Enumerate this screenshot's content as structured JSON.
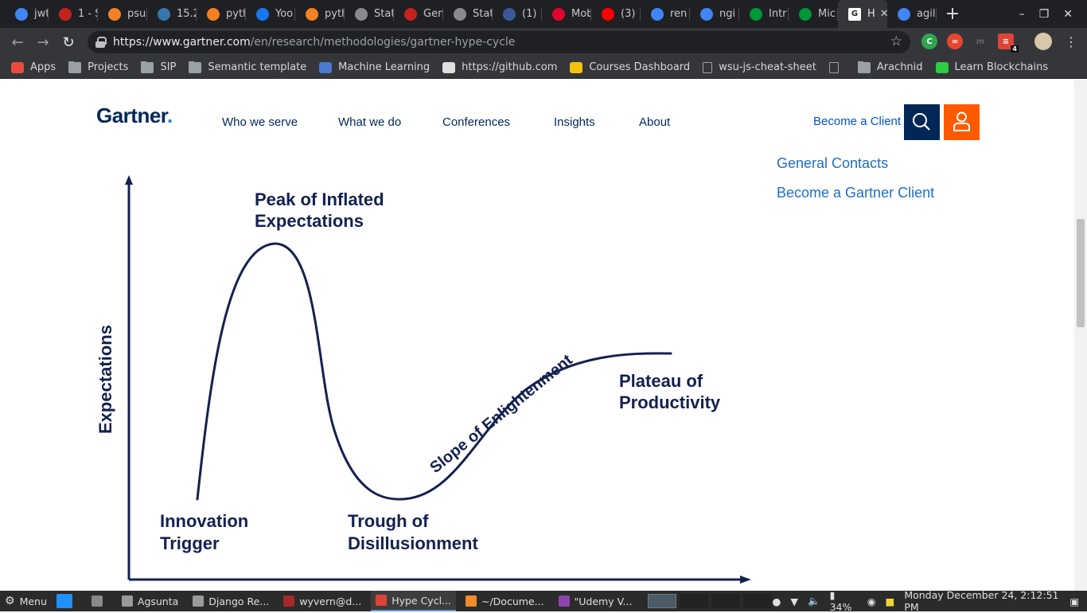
{
  "browser": {
    "tabs": [
      {
        "label": "jwt",
        "icon": "google-icon",
        "color": "#4285f4"
      },
      {
        "label": "1 - S",
        "icon": "red-figure-icon",
        "color": "#c5221f"
      },
      {
        "label": "psu",
        "icon": "stackoverflow-icon",
        "color": "#f48024"
      },
      {
        "label": "15.2",
        "icon": "python-icon",
        "color": "#3776ab"
      },
      {
        "label": "pyth",
        "icon": "stackoverflow-icon",
        "color": "#f48024"
      },
      {
        "label": "Yoo",
        "icon": "messenger-icon",
        "color": "#1877f2"
      },
      {
        "label": "pyth",
        "icon": "stackoverflow-icon",
        "color": "#f48024"
      },
      {
        "label": "Stat",
        "icon": "page-icon",
        "color": "#8a8a8a"
      },
      {
        "label": "Gen",
        "icon": "red-figure-icon",
        "color": "#c5221f"
      },
      {
        "label": "Stat",
        "icon": "page-icon",
        "color": "#8a8a8a"
      },
      {
        "label": "(1)",
        "icon": "facebook-icon",
        "color": "#3b5998"
      },
      {
        "label": "Mob",
        "icon": "huawei-icon",
        "color": "#e3002b"
      },
      {
        "label": "(3)",
        "icon": "youtube-icon",
        "color": "#ff0000"
      },
      {
        "label": "ren",
        "icon": "google-icon",
        "color": "#4285f4"
      },
      {
        "label": "ngi",
        "icon": "google-icon",
        "color": "#4285f4"
      },
      {
        "label": "Intr",
        "icon": "nginx-icon",
        "color": "#009639"
      },
      {
        "label": "Mic",
        "icon": "nginx-icon",
        "color": "#009639"
      },
      {
        "label": "H",
        "icon": "gartner-icon",
        "color": "#ffffff",
        "active": true
      },
      {
        "label": "agil",
        "icon": "google-icon",
        "color": "#4285f4"
      }
    ],
    "url_host": "https://www.gartner.com",
    "url_path": "/en/research/methodologies/gartner-hype-cycle",
    "bookmarks": [
      {
        "label": "Apps",
        "icon": "apps-grid-icon"
      },
      {
        "label": "Projects",
        "icon": "folder-icon"
      },
      {
        "label": "SIP",
        "icon": "folder-icon"
      },
      {
        "label": "Semantic template",
        "icon": "folder-icon"
      },
      {
        "label": "Machine Learning",
        "icon": "infinity-icon"
      },
      {
        "label": "https://github.com",
        "icon": "github-icon"
      },
      {
        "label": "Courses Dashboard",
        "icon": "courses-icon"
      },
      {
        "label": "wsu-js-cheat-sheet",
        "icon": "page-icon"
      },
      {
        "label": "",
        "icon": "page-icon"
      },
      {
        "label": "Arachnid",
        "icon": "folder-icon"
      },
      {
        "label": "Learn Blockchains",
        "icon": "blockchain-icon"
      }
    ],
    "extension_badge": "4"
  },
  "site": {
    "logo": "Gartner",
    "logo_dot": ".",
    "nav": [
      "Who we serve",
      "What we do",
      "Conferences",
      "Insights",
      "About"
    ],
    "become_client": "Become a Client",
    "side_links": [
      "General Contacts",
      "Become a Gartner Client"
    ]
  },
  "hype_cycle": {
    "y_axis_label": "Expectations",
    "phases": {
      "innovation_trigger": [
        "Innovation",
        "Trigger"
      ],
      "peak": [
        "Peak of Inflated",
        "Expectations"
      ],
      "trough": [
        "Trough of",
        "Disillusionment"
      ],
      "slope": "Slope of Enlightenment",
      "plateau": [
        "Plateau of",
        "Productivity"
      ]
    },
    "curve_color": "#14214f"
  },
  "taskbar": {
    "menu": "Menu",
    "items": [
      {
        "label": "",
        "icon": "blue-square-icon"
      },
      {
        "label": "",
        "icon": "file-manager-icon"
      },
      {
        "label": "Agsunta",
        "icon": "folder-icon"
      },
      {
        "label": "Django Re...",
        "icon": "folder-icon"
      },
      {
        "label": "wyvern@d...",
        "icon": "terminal-icon"
      },
      {
        "label": "Hype Cycl...",
        "icon": "chrome-icon",
        "active": true
      },
      {
        "label": "~/Docume...",
        "icon": "sublime-icon"
      },
      {
        "label": "\"Udemy V...",
        "icon": "video-icon"
      }
    ],
    "battery": "34%",
    "clock": "Monday December 24,  2:12:51 PM"
  }
}
